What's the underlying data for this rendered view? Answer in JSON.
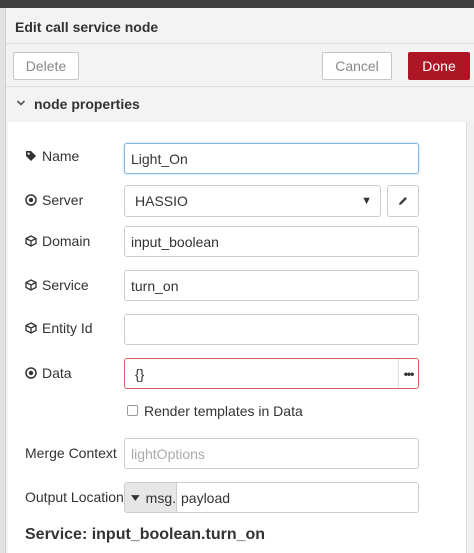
{
  "header": {
    "title": "Edit call service node"
  },
  "toolbar": {
    "delete_label": "Delete",
    "cancel_label": "Cancel",
    "done_label": "Done",
    "done_color": "#ad1625"
  },
  "section": {
    "title": "node properties",
    "chevron_icon": "chevron-down-icon"
  },
  "fields": {
    "name": {
      "label": "Name",
      "icon": "tag-icon",
      "value": "Light_On"
    },
    "server": {
      "label": "Server",
      "icon": "dot-circle-icon",
      "value": "HASSIO",
      "edit_icon": "pencil-icon"
    },
    "domain": {
      "label": "Domain",
      "icon": "cube-icon",
      "value": "input_boolean"
    },
    "service": {
      "label": "Service",
      "icon": "cube-icon",
      "value": "turn_on"
    },
    "entity_id": {
      "label": "Entity Id",
      "icon": "cube-icon",
      "value": ""
    },
    "data": {
      "label": "Data",
      "icon": "dot-circle-icon",
      "value": "{}",
      "expand_label": "•••"
    },
    "render_templates": {
      "label": "Render templates in Data",
      "checked": false
    },
    "merge_context": {
      "label": "Merge Context",
      "placeholder": "lightOptions",
      "value": ""
    },
    "output_location": {
      "label": "Output Location",
      "type_label": "msg.",
      "value": "payload"
    }
  },
  "summary": {
    "text": "Service: input_boolean.turn_on"
  }
}
